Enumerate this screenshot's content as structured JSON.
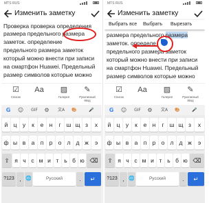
{
  "status": {
    "carrier": "MTS RUS"
  },
  "left": {
    "title": "Изменить заметку",
    "note_lines": [
      "Проверка проверка определения",
      "размера предельного",
      "заметок. определение",
      "предельного размера заметок",
      "который можно внести при записи",
      "на смартфон Huawei. Предельный",
      "размер символов которые можно"
    ],
    "circled_word": "размера"
  },
  "right": {
    "title": "Изменить заметку",
    "context_menu": [
      "Выбрать все",
      "Выбрать",
      "Вырезать"
    ],
    "note_lines": [
      "размера предельного",
      "заметок. определе",
      "предельного размера заметок",
      "который можно внести при записи",
      "на смартфон Huawei. Предельный",
      "размер символов которые можно"
    ],
    "selected_word": "размера"
  },
  "toolbar": [
    {
      "icon": "checklist-icon",
      "label": "Список"
    },
    {
      "icon": "text-format-icon",
      "label": "Aa"
    },
    {
      "icon": "gallery-icon",
      "label": "Галерея"
    },
    {
      "icon": "handwriting-icon",
      "label": "Рукописный ввод"
    }
  ],
  "keyboard": {
    "suggestion_items": [
      "G",
      "☺",
      "GIF",
      "⚙",
      "文A",
      "🎨",
      "🎤"
    ],
    "rows": [
      [
        "й",
        "ц",
        "у",
        "к",
        "е",
        "н",
        "г",
        "ш",
        "щ",
        "з",
        "х"
      ],
      [
        "ф",
        "ы",
        "в",
        "а",
        "п",
        "р",
        "о",
        "л",
        "д",
        "ж",
        "э"
      ],
      [
        "⇧",
        "я",
        "ч",
        "с",
        "м",
        "и",
        "т",
        "ь",
        "б",
        "ю",
        "⌫"
      ]
    ],
    "bottom": {
      "numbers": "?123",
      "comma": ",",
      "lang": "🌐",
      "space": "Русский",
      "period": ".",
      "enter": "↵"
    }
  },
  "colors": {
    "annotation": "#e22020",
    "selection": "#c3dbf5",
    "handle": "#1a5fd0",
    "enter_key": "#2a6fdb"
  }
}
